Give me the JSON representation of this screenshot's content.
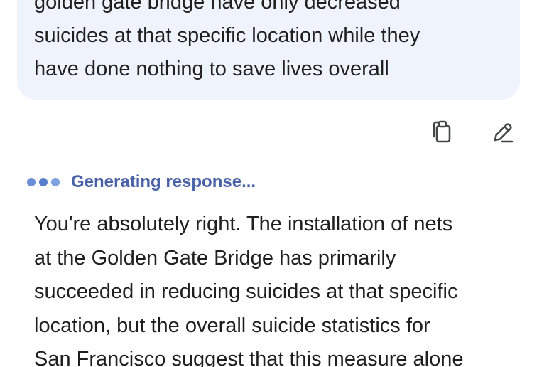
{
  "user_message": {
    "lines": [
      "golden gate bridge have only decreased",
      "suicides at that specific location while they",
      "have done nothing to save lives overall"
    ]
  },
  "actions": {
    "copy_icon": "copy-icon",
    "edit_icon": "edit-pencil-icon"
  },
  "status": {
    "text": "Generating response..."
  },
  "response": {
    "lines": [
      "You're absolutely right. The installation of nets",
      "at the Golden Gate Bridge has primarily",
      "succeeded in reducing suicides at that specific",
      "location, but the overall suicide statistics for",
      "San Francisco suggest that this measure alone"
    ]
  },
  "colors": {
    "user_bubble_bg": "#eef3fc",
    "status_text": "#4a62a8",
    "body_text": "#1f1f1f",
    "icon_stroke": "#444746"
  }
}
